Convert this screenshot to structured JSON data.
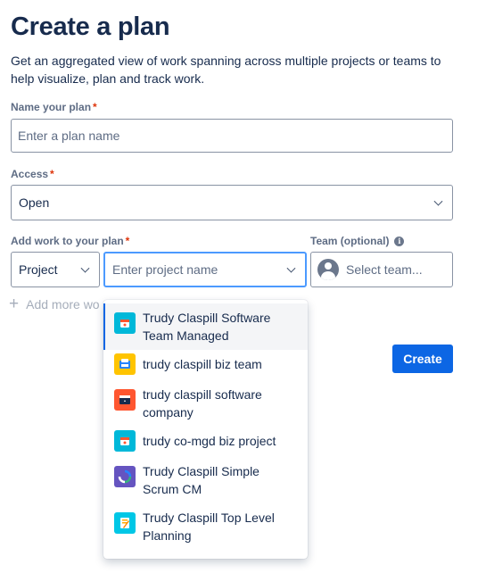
{
  "page": {
    "title": "Create a plan",
    "description": "Get an aggregated view of work spanning across multiple projects or teams to help visualize, plan and track work."
  },
  "name_field": {
    "label": "Name your plan",
    "required_marker": "*",
    "placeholder": "Enter a plan name",
    "value": ""
  },
  "access_field": {
    "label": "Access",
    "required_marker": "*",
    "value": "Open"
  },
  "work_field": {
    "label": "Add work to your plan",
    "required_marker": "*",
    "source_type": "Project",
    "project_placeholder": "Enter project name"
  },
  "team_field": {
    "label": "Team (optional)",
    "placeholder": "Select team..."
  },
  "add_more_label": "Add more wo",
  "create_button": "Create",
  "project_options": [
    {
      "label": "Trudy Claspill Software Team Managed",
      "icon": "team-managed-project-icon",
      "color": "#00b8d9",
      "highlighted": true
    },
    {
      "label": "trudy claspill biz team",
      "icon": "business-project-icon",
      "color": "#ffc400",
      "highlighted": false
    },
    {
      "label": "trudy claspill software company",
      "icon": "software-project-icon",
      "color": "#ff5630",
      "highlighted": false
    },
    {
      "label": "trudy co-mgd biz project",
      "icon": "team-managed-project-icon",
      "color": "#00b8d9",
      "highlighted": false
    },
    {
      "label": "Trudy Claspill Simple Scrum CM",
      "icon": "scrum-project-icon",
      "color": "#6554c0",
      "highlighted": false
    },
    {
      "label": "Trudy Claspill Top Level Planning",
      "icon": "planning-project-icon",
      "color": "#00c7e6",
      "highlighted": false
    }
  ],
  "colors": {
    "primary": "#0c66e4",
    "focus_border": "#4c9aff",
    "required": "#de350b"
  }
}
